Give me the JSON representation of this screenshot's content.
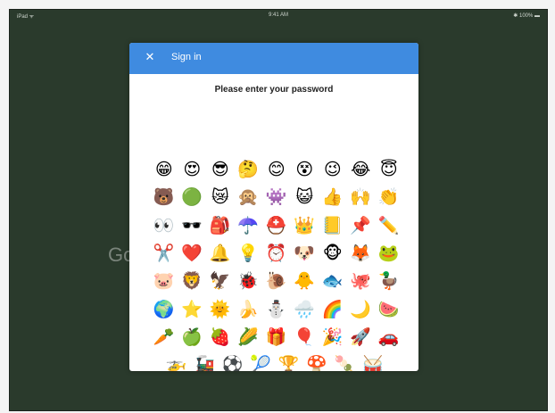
{
  "status_bar": {
    "left": "iPad ᯤ",
    "center": "9:41 AM",
    "right": "✱ 100% ▬"
  },
  "background": {
    "logo_text": "Go"
  },
  "dialog": {
    "title": "Sign in",
    "close_icon": "close-icon",
    "prompt": "Please enter your password",
    "header_color": "#3f8be0"
  },
  "emoji_rows": [
    [
      "😁",
      "😍",
      "😎",
      "🤔",
      "😊",
      "😵",
      "😉",
      "😂",
      "😇"
    ],
    [
      "🐻",
      "🟢",
      "😿",
      "🙊",
      "👾",
      "😺",
      "👍",
      "🙌",
      "👏"
    ],
    [
      "👀",
      "🕶️",
      "🎒",
      "☂️",
      "⛑️",
      "👑",
      "📒",
      "📌",
      "✏️"
    ],
    [
      "✂️",
      "❤️",
      "🔔",
      "💡",
      "⏰",
      "🐶",
      "🐵",
      "🦊",
      "🐸"
    ],
    [
      "🐷",
      "🦁",
      "🦅",
      "🐞",
      "🐌",
      "🐥",
      "🐟",
      "🐙",
      "🦆"
    ],
    [
      "🌍",
      "⭐",
      "🌞",
      "🍌",
      "⛄",
      "🌧️",
      "🌈",
      "🌙",
      "🍉"
    ],
    [
      "🥕",
      "🍏",
      "🍓",
      "🌽",
      "🎁",
      "🎈",
      "🎉",
      "🚀",
      "🚗"
    ],
    [
      "🚁",
      "🚂",
      "⚽",
      "🎾",
      "🏆",
      "🍄",
      "🍡",
      "🥁"
    ]
  ]
}
